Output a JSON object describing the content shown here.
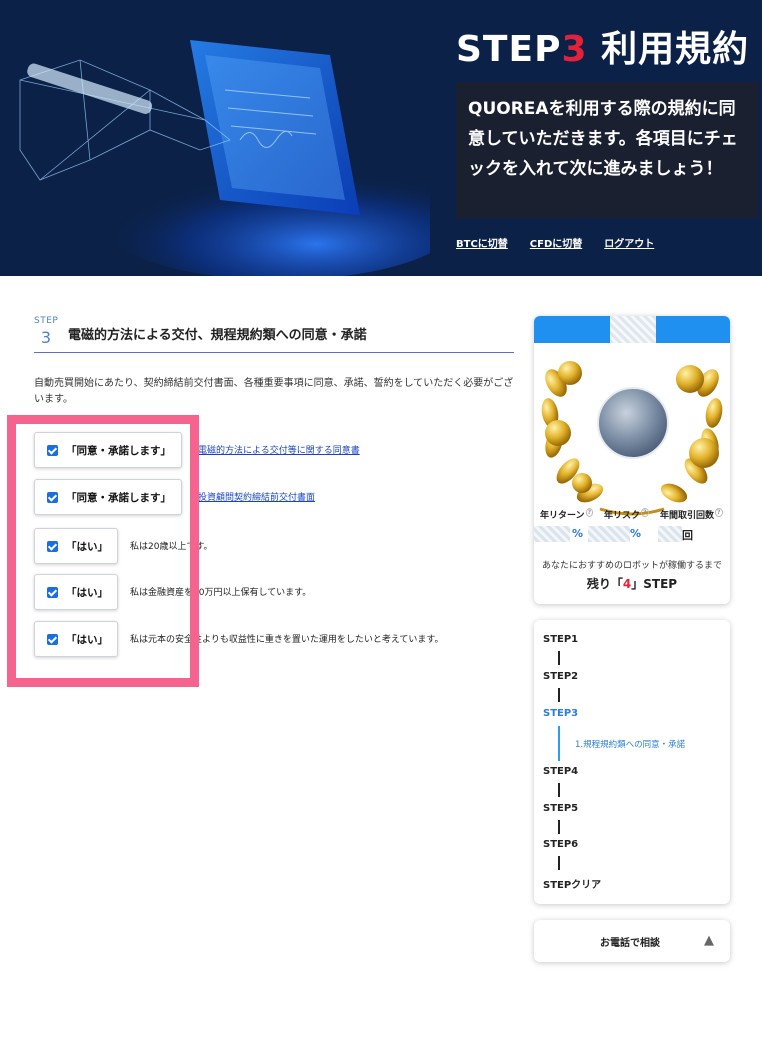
{
  "hero": {
    "title_step": "STEP",
    "title_num": "3",
    "title_rest": " 利用規約",
    "description": "QUOREAを利用する際の規約に同意していただきます。各項目にチェックを入れて次に進みましょう！",
    "links": [
      "BTCに切替",
      "CFDに切替",
      "ログアウト"
    ]
  },
  "section": {
    "step_word": "STEP",
    "step_num": "3",
    "title": "電磁的方法による交付、規程規約類への同意・承諾",
    "intro": "自動売買開始にあたり、契約締結前交付書面、各種重要事項に同意、承諾、誓約をしていただく必要がございます。"
  },
  "agreements": [
    {
      "button_label": "「同意・承諾します」",
      "text": "電磁的方法による交付等に関する同意書",
      "checked": true
    },
    {
      "button_label": "「同意・承諾します」",
      "text": "投資顧問契約締結前交付書面",
      "checked": true
    },
    {
      "button_label": "「はい」",
      "text": "私は20歳以上です。",
      "checked": true
    },
    {
      "button_label": "「はい」",
      "text": "私は金融資産を10万円以上保有しています。",
      "checked": true
    },
    {
      "button_label": "「はい」",
      "text": "私は元本の安全性よりも収益性に重きを置いた運用をしたいと考えています。",
      "checked": true
    }
  ],
  "robot_card": {
    "annual_return_label": "年リターン",
    "annual_risk_label": "年リスク",
    "trades_label": "年間取引回数",
    "help_mark": "?",
    "unit_percent": "%",
    "unit_times": "回",
    "remaining_note": "あなたにおすすめのロボットが稼働するまで",
    "remaining_prefix": "残り「",
    "remaining_num": "4",
    "remaining_suffix": "」STEP"
  },
  "steps": {
    "items": [
      "STEP1",
      "STEP2",
      "STEP3",
      "STEP4",
      "STEP5",
      "STEP6",
      "STEPクリア"
    ],
    "active": "STEP3",
    "sub_item": "1.規程規約類への同意・承諾"
  },
  "phone": {
    "label": "お電話で相談",
    "arrow": "▲"
  },
  "colors": {
    "hero_bg": "#0b2147",
    "accent_red": "#e3223a",
    "accent_blue": "#2a7fd8",
    "highlight_pink": "#f4648e"
  }
}
